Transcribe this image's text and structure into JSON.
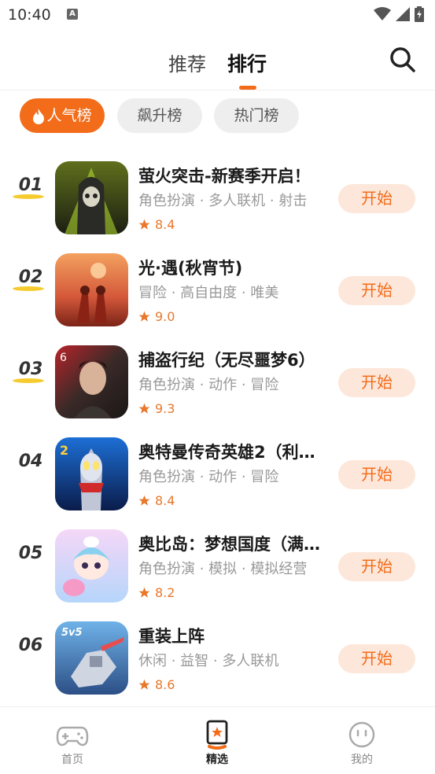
{
  "status_bar": {
    "time": "10:40",
    "notif_letter": "A"
  },
  "header": {
    "tabs": [
      {
        "label": "推荐",
        "active": false
      },
      {
        "label": "排行",
        "active": true
      }
    ],
    "search_icon": "search-icon"
  },
  "filters": {
    "chips": [
      {
        "label": "人气榜",
        "active": true,
        "icon": "flame-icon"
      },
      {
        "label": "飙升榜",
        "active": false
      },
      {
        "label": "热门榜",
        "active": false
      }
    ]
  },
  "list": {
    "items": [
      {
        "rank": "01",
        "name": "萤火突击-新赛季开启！",
        "tags": "角色扮演 · 多人联机 · 射击",
        "rating": "8.4",
        "button": "开始"
      },
      {
        "rank": "02",
        "name": "光·遇(秋宵节)",
        "tags": "冒险 · 高自由度 · 唯美",
        "rating": "9.0",
        "button": "开始"
      },
      {
        "rank": "03",
        "name": "捕盗行纪（无尽噩梦6）",
        "tags": "角色扮演 · 动作 · 冒险",
        "rating": "9.3",
        "button": "开始"
      },
      {
        "rank": "04",
        "name": "奥特曼传奇英雄2（利…",
        "tags": "角色扮演 · 动作 · 冒险",
        "rating": "8.4",
        "button": "开始"
      },
      {
        "rank": "05",
        "name": "奥比岛：梦想国度（满…",
        "tags": "角色扮演 · 模拟 · 模拟经营",
        "rating": "8.2",
        "button": "开始"
      },
      {
        "rank": "06",
        "name": "重装上阵",
        "tags": "休闲 · 益智 · 多人联机",
        "rating": "8.6",
        "button": "开始"
      }
    ]
  },
  "bottom_nav": {
    "items": [
      {
        "label": "首页",
        "icon": "gamepad-icon",
        "active": false
      },
      {
        "label": "精选",
        "icon": "star-bookmark-icon",
        "active": true
      },
      {
        "label": "我的",
        "icon": "smiley-face-icon",
        "active": false
      }
    ]
  },
  "colors": {
    "accent": "#f26c1a",
    "button_bg": "#fde7da",
    "rank_underline": "#f5c518",
    "rating": "#e9782c"
  }
}
